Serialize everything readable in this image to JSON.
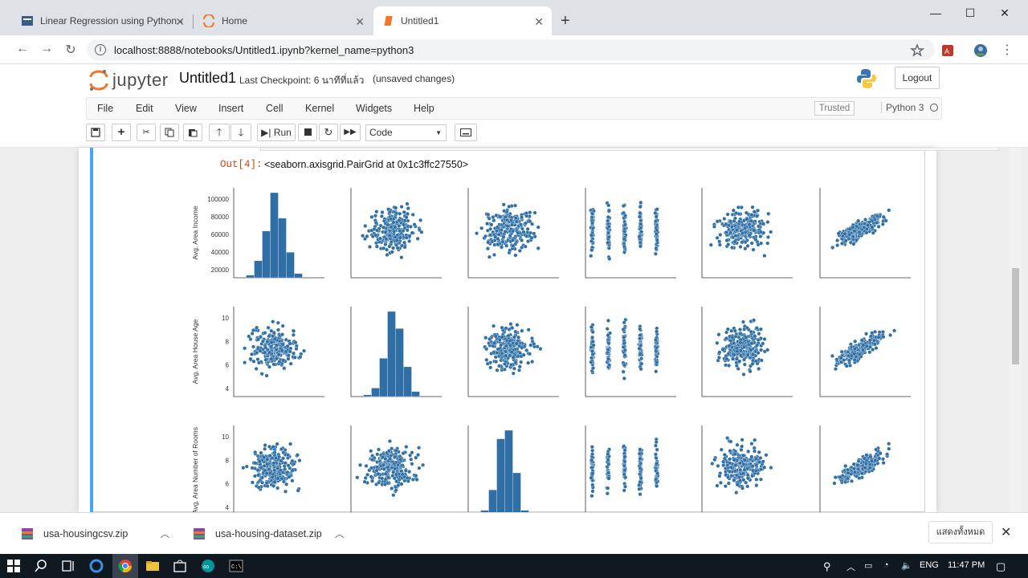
{
  "browser": {
    "tabs": [
      {
        "title": "Linear Regression using Python -",
        "active": false
      },
      {
        "title": "Home",
        "active": false
      },
      {
        "title": "Untitled1",
        "active": true
      }
    ],
    "url": "localhost:8888/notebooks/Untitled1.ipynb?kernel_name=python3"
  },
  "jupyter": {
    "logo_text": "jupyter",
    "notebook_name": "Untitled1",
    "checkpoint": "Last Checkpoint: 6 นาทีที่แล้ว",
    "unsaved": "(unsaved changes)",
    "logout": "Logout",
    "menu": [
      "File",
      "Edit",
      "View",
      "Insert",
      "Cell",
      "Kernel",
      "Widgets",
      "Help"
    ],
    "trusted": "Trusted",
    "kernel": "Python 3",
    "run_label": "Run",
    "cell_type": "Code"
  },
  "cell": {
    "out_prompt": "Out[4]:",
    "out_text": "<seaborn.axisgrid.PairGrid at 0x1c3ffc27550>"
  },
  "chart_data": {
    "type": "scatter",
    "title": "",
    "row_labels": [
      "Avg. Area Income",
      "Avg. Area House Age",
      "Avg. Area Number of Rooms"
    ],
    "row_ticks": [
      [
        "20000",
        "40000",
        "60000",
        "80000",
        "100000"
      ],
      [
        "4",
        "6",
        "8",
        "10"
      ],
      [
        "4",
        "6",
        "8",
        "10"
      ]
    ],
    "diag_hist": [
      [
        0.03,
        0.2,
        0.55,
        1.0,
        0.7,
        0.3,
        0.05
      ],
      [
        0.02,
        0.1,
        0.45,
        1.0,
        0.8,
        0.35,
        0.06
      ],
      [
        0.06,
        0.3,
        0.9,
        1.0,
        0.5,
        0.06,
        0.0
      ]
    ],
    "columns": 6,
    "grid": false,
    "legend": "none"
  },
  "downloads": [
    {
      "name": "usa-housingcsv.zip"
    },
    {
      "name": "usa-housing-dataset.zip"
    }
  ],
  "download_show_all": "แสดงทั้งหมด",
  "taskbar": {
    "lang": "ENG",
    "time": "11:47 PM"
  },
  "colors": {
    "accent": "#2f6fa6",
    "cell_bar": "#42a5f5",
    "out_prompt": "#d84315"
  }
}
